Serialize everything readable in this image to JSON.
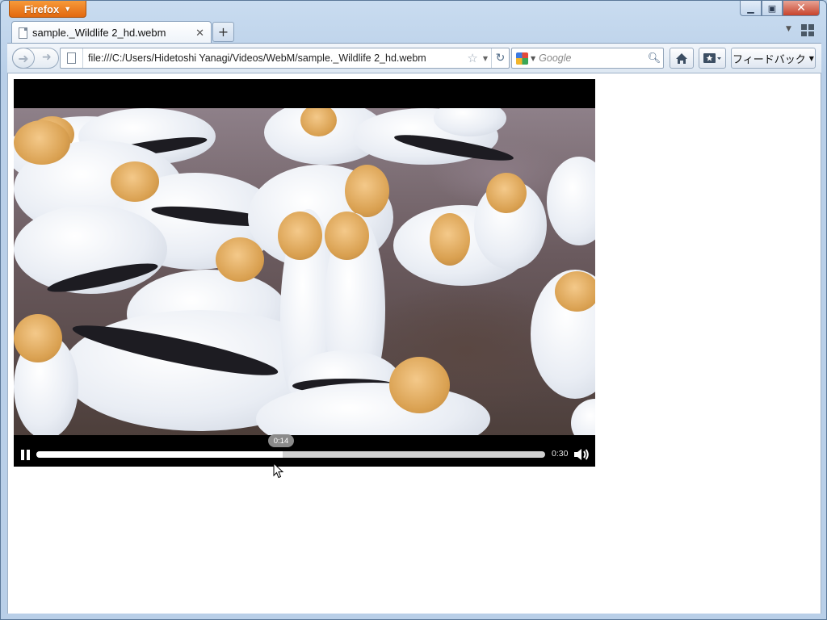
{
  "browser": {
    "menu_button_label": "Firefox",
    "tab": {
      "title": "sample._Wildlife 2_hd.webm"
    },
    "new_tab_label": "+",
    "url": "file:///C:/Users/Hidetoshi Yanagi/Videos/WebM/sample._Wildlife 2_hd.webm",
    "search": {
      "engine": "Google",
      "placeholder": "Google"
    },
    "feedback_label": "フィードバック"
  },
  "video": {
    "current_time_label": "0:14",
    "duration_label": "0:30",
    "progress_fraction": 0.484,
    "state": "playing",
    "volume": "on"
  },
  "colors": {
    "firefox_orange": "#e2680f",
    "close_red": "#c7432c",
    "video_bar": "#000000"
  }
}
